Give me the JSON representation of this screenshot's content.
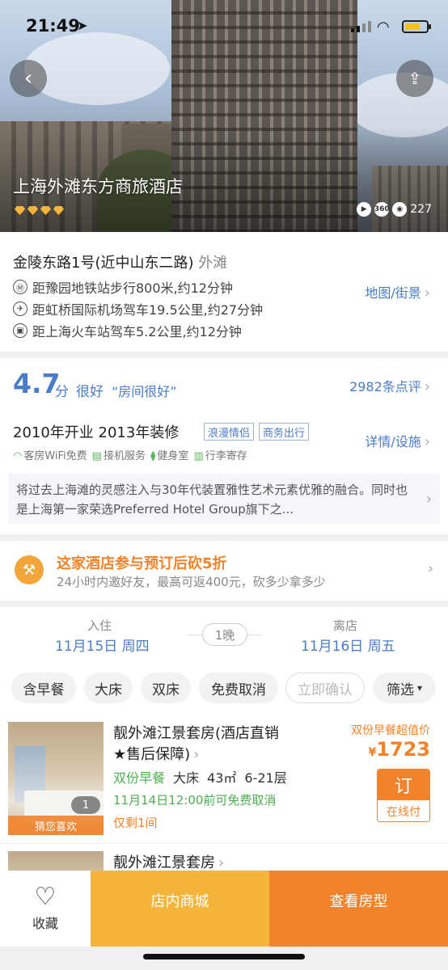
{
  "status_bar": {
    "time": "21:49",
    "location_icon": "location-arrow-icon"
  },
  "hero": {
    "hotel_name": "上海外滩东方商旅酒店",
    "star_count": 4,
    "media_360": "360",
    "photo_count": "227",
    "back_icon": "chevron-left-icon",
    "share_icon": "share-icon"
  },
  "address": {
    "street": "金陵东路1号(近中山东二路)",
    "area": "外滩",
    "distances": [
      {
        "icon": "metro-icon",
        "text": "距豫园地铁站步行800米,约12分钟"
      },
      {
        "icon": "plane-icon",
        "text": "距虹桥国际机场驾车19.5公里,约27分钟"
      },
      {
        "icon": "train-icon",
        "text": "距上海火车站驾车5.2公里,约12分钟"
      }
    ],
    "map_link": "地图/街景"
  },
  "rating": {
    "score": "4.7",
    "unit": "分",
    "word": "很好",
    "quote": "“房间很好”",
    "reviews_link": "2982条点评",
    "open_year": "2010年开业 2013年装修",
    "tags": [
      "浪漫情侣",
      "商务出行"
    ],
    "details_link": "详情/设施",
    "facilities": [
      "客房WiFi免费",
      "接机服务",
      "健身室",
      "行李寄存"
    ],
    "intro": "将过去上海滩的灵感注入与30年代装置雅性艺术元素优雅的融合。同时也是上海第一家荣选Preferred Hotel Group旗下之..."
  },
  "promo": {
    "title": "这家酒店参与预订后砍5折",
    "subtitle": "24小时内邀好友，最高可返400元，砍多少拿多少"
  },
  "dates": {
    "checkin_label": "入住",
    "checkin_date": "11月15日 周四",
    "nights": "1晚",
    "checkout_label": "离店",
    "checkout_date": "11月16日 周五"
  },
  "filters": [
    "含早餐",
    "大床",
    "双床",
    "免费取消",
    "立即确认",
    "筛选"
  ],
  "rooms": [
    {
      "name_line1": "靓外滩江景套房(酒店直销",
      "name_line2": "★售后保障)",
      "photo_count": "1",
      "badge": "猜您喜欢",
      "breakfast": "双份早餐",
      "bed": "大床",
      "size": "43㎡",
      "floor": "6-21层",
      "cancel": "11月14日12:00前可免费取消",
      "left": "仅剩1间",
      "deal": "双份早餐超值价",
      "currency": "¥",
      "price": "1723",
      "book_label": "订",
      "pay_label": "在线付"
    },
    {
      "name_line1": "靓外滩江景套房"
    }
  ],
  "bottom_bar": {
    "favorite_label": "收藏",
    "mall_label": "店内商城",
    "rooms_label": "查看房型"
  },
  "colors": {
    "accent_blue": "#4a7cc8",
    "accent_orange": "#f2832b",
    "mall_yellow": "#f5b43a"
  }
}
